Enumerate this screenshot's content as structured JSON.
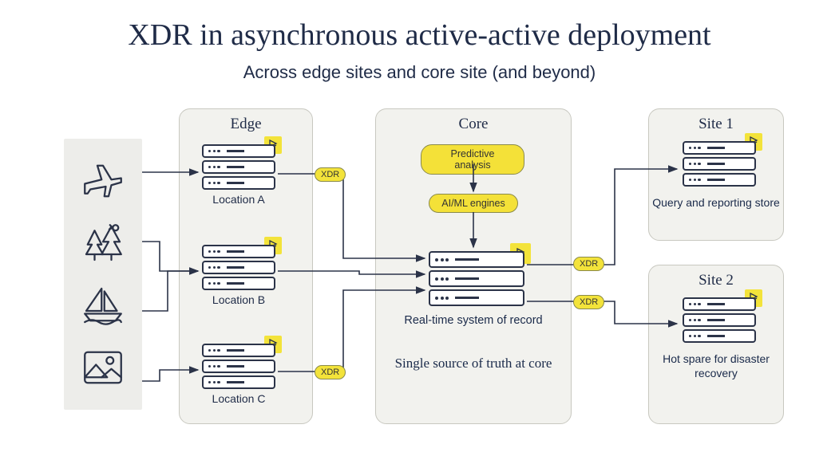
{
  "title": "XDR in asynchronous active-active deployment",
  "subtitle": "Across edge sites and core site (and beyond)",
  "sources": {
    "icons": [
      "airplane",
      "trees",
      "sailboat",
      "mountain-photo"
    ]
  },
  "edge": {
    "title": "Edge",
    "locations": [
      {
        "label": "Location A",
        "xdr": "XDR"
      },
      {
        "label": "Location B"
      },
      {
        "label": "Location C",
        "xdr": "XDR"
      }
    ]
  },
  "core": {
    "title": "Core",
    "pill1": "Predictive analysis",
    "pill2": "AI/ML engines",
    "label1": "Real-time system of record",
    "label2": "Single source of truth at core",
    "xdr_out1": "XDR",
    "xdr_out2": "XDR"
  },
  "site1": {
    "title": "Site 1",
    "label": "Query and reporting store"
  },
  "site2": {
    "title": "Site 2",
    "label": "Hot spare for disaster recovery"
  }
}
